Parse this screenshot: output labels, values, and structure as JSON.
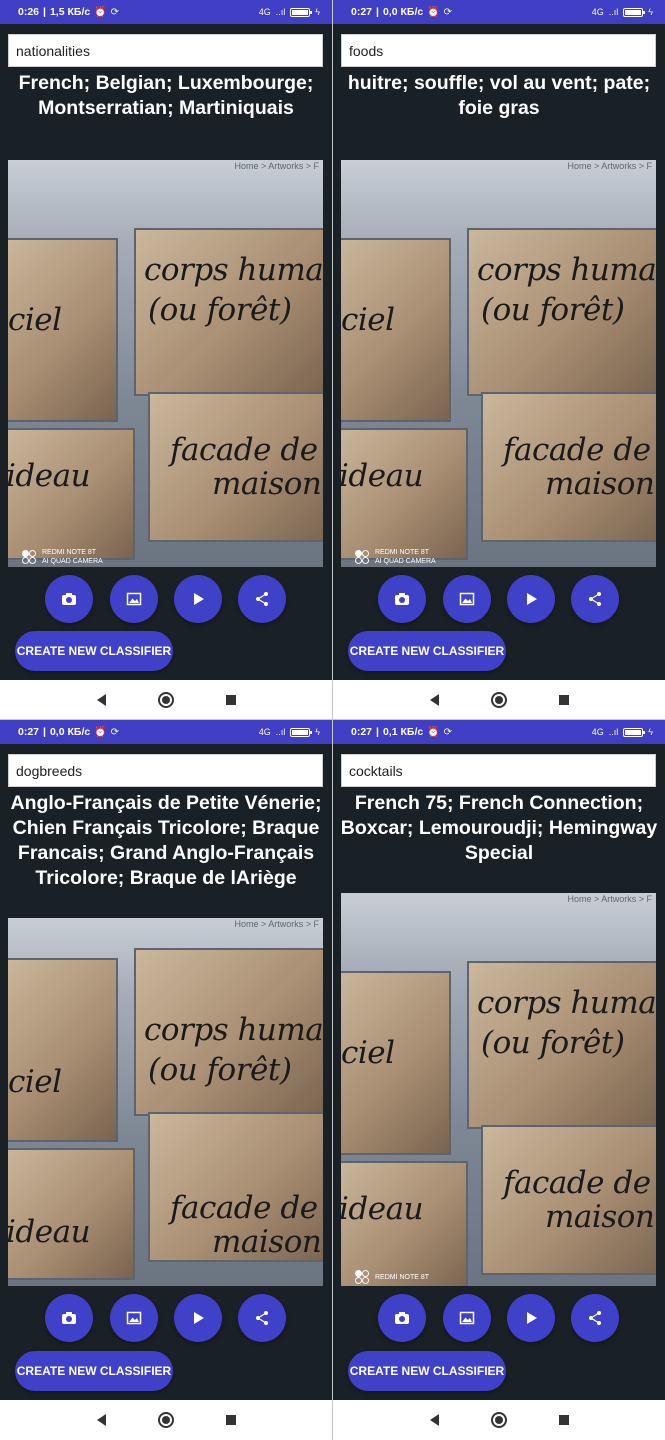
{
  "screens": [
    {
      "status": {
        "time": "0:26",
        "speed": "1,5 КБ/с"
      },
      "input": {
        "value": "nationalities"
      },
      "result": "French; Belgian; Luxembourge; Montserratian; Martiniquais",
      "photo_watermark": {
        "line1": "REDMI NOTE 8T",
        "line2": "AI QUAD CAMERA"
      },
      "buttons": {
        "create": "CREATE NEW CLASSIFIER"
      }
    },
    {
      "status": {
        "time": "0:27",
        "speed": "0,0 КБ/с"
      },
      "input": {
        "value": "foods"
      },
      "result": "huitre; souffle; vol au vent; pate; foie gras",
      "photo_watermark": {
        "line1": "REDMI NOTE 8T",
        "line2": "AI QUAD CAMERA"
      },
      "buttons": {
        "create": "CREATE NEW CLASSIFIER"
      }
    },
    {
      "status": {
        "time": "0:27",
        "speed": "0,0 КБ/с"
      },
      "input": {
        "value": "dogbreeds"
      },
      "result": "Anglo-Français de Petite Vénerie; Chien Français Tricolore; Braque Francais; Grand Anglo-Français Tricolore; Braque de lAriège",
      "buttons": {
        "create": "CREATE NEW CLASSIFIER"
      }
    },
    {
      "status": {
        "time": "0:27",
        "speed": "0,1 КБ/с"
      },
      "input": {
        "value": "cocktails"
      },
      "result": "French 75; French Connection; Boxcar; Lemouroudji; Hemingway Special",
      "photo_watermark": {
        "line1": "REDMI NOTE 8T"
      },
      "buttons": {
        "create": "CREATE NEW CLASSIFIER"
      }
    }
  ],
  "photo_text": {
    "breadcrumb": "Home > Artworks > F",
    "top_right": [
      "corps humain",
      "(ou forêt)"
    ],
    "left_top": "ciel",
    "left_bottom": "ideau",
    "bottom_right": [
      "facade de",
      "maison"
    ]
  },
  "status_right": {
    "network": "4G",
    "signal": "..ıl"
  },
  "icons": {
    "camera": "camera-icon",
    "gallery": "gallery-icon",
    "play": "play-icon",
    "share": "share-icon",
    "back": "back-icon",
    "home": "home-icon",
    "recent": "recent-apps-icon"
  },
  "colors": {
    "status_bar": "#3f3ec4",
    "accent_button": "#3f41c9",
    "screen_background": "#1a2126",
    "text_on_dark": "#ffffff"
  }
}
